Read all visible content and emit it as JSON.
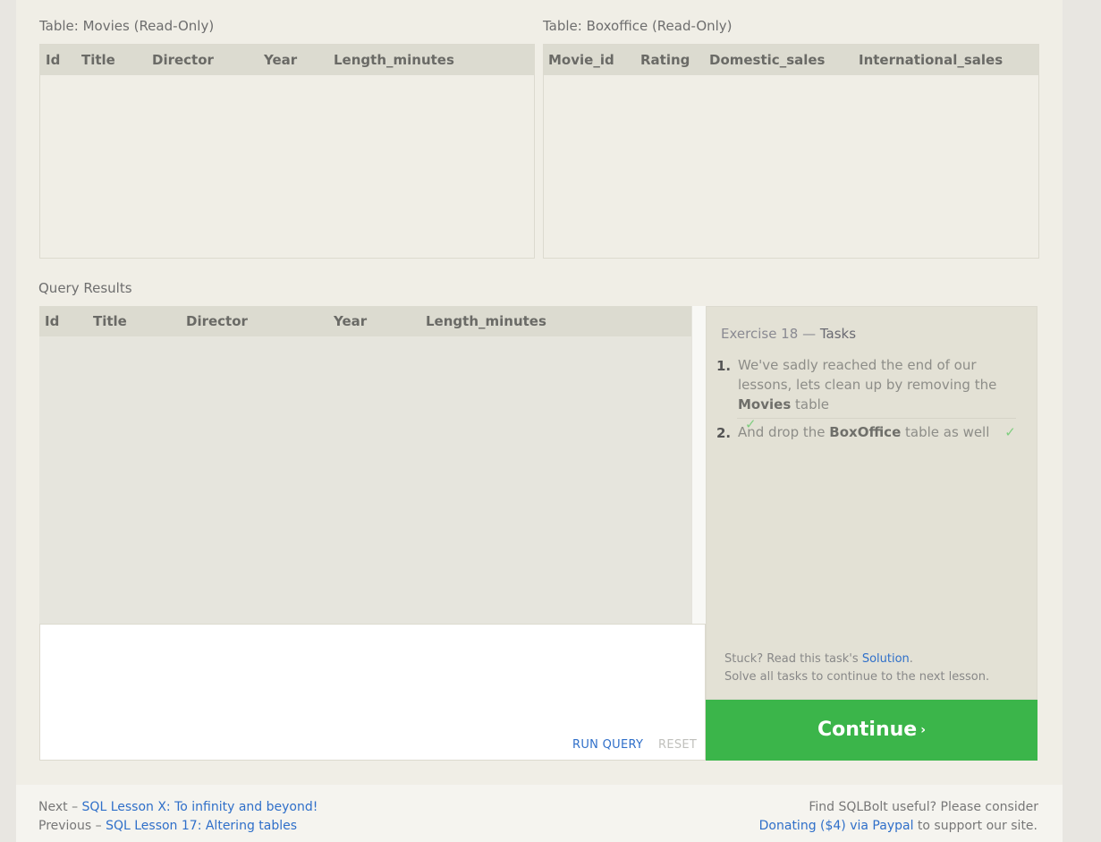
{
  "movies_table": {
    "caption": "Table: Movies (Read-Only)",
    "columns": [
      "Id",
      "Title",
      "Director",
      "Year",
      "Length_minutes"
    ]
  },
  "boxoffice_table": {
    "caption": "Table: Boxoffice (Read-Only)",
    "columns": [
      "Movie_id",
      "Rating",
      "Domestic_sales",
      "International_sales"
    ]
  },
  "results": {
    "caption": "Query Results",
    "columns": [
      "Id",
      "Title",
      "Director",
      "Year",
      "Length_minutes"
    ]
  },
  "editor": {
    "run_label": "RUN QUERY",
    "reset_label": "RESET"
  },
  "tasks": {
    "exercise": "Exercise 18",
    "dash": "—",
    "title": "Tasks",
    "items": [
      {
        "num": "1.",
        "text_before": "We've sadly reached the end of our lessons, lets clean up by removing the",
        "bold": "Movies",
        "text_after": "table",
        "check": "✓"
      },
      {
        "num": "2.",
        "text_before": "And drop the",
        "bold": "BoxOffice",
        "text_after": "table as well",
        "check": "✓"
      }
    ],
    "hint_prefix": "Stuck? Read this task's",
    "hint_link": "Solution",
    "hint_suffix": ".",
    "hint2": "Solve all tasks to continue to the next lesson."
  },
  "continue": {
    "label": "Continue",
    "arrow": "›"
  },
  "footer": {
    "next_prefix": "Next –",
    "next_link": "SQL Lesson X: To infinity and beyond!",
    "prev_prefix": "Previous –",
    "prev_link": "SQL Lesson 17: Altering tables",
    "support_line1": "Find SQLBolt useful? Please consider",
    "donate_link": "Donating ($4) via Paypal",
    "support_suffix": "to support our site."
  }
}
